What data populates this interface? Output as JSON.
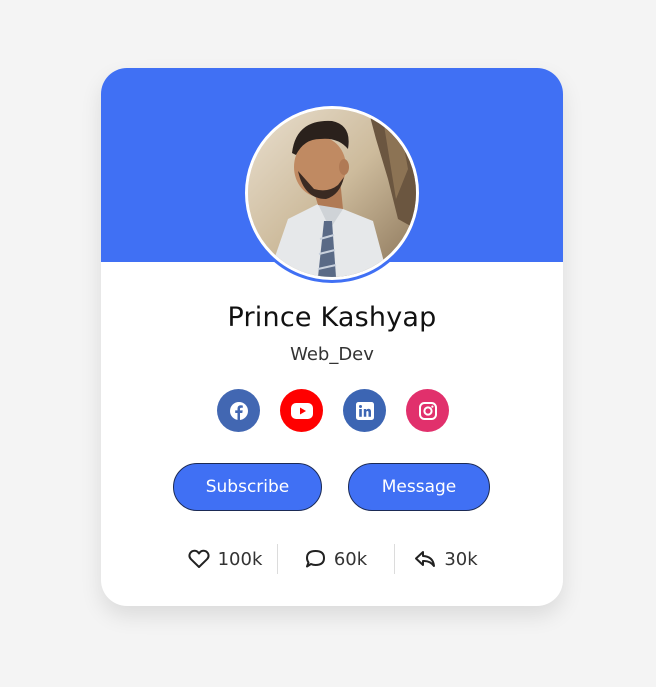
{
  "profile": {
    "name": "Prince Kashyap",
    "job": "Web_Dev"
  },
  "socials": [
    {
      "icon": "facebook-icon",
      "color": "#4267b2"
    },
    {
      "icon": "youtube-icon",
      "color": "#ff0000"
    },
    {
      "icon": "linkedin-icon",
      "color": "#3c65b3"
    },
    {
      "icon": "instagram-icon",
      "color": "#e1306c"
    }
  ],
  "buttons": {
    "subscribe": "Subscribe",
    "message": "Message"
  },
  "stats": {
    "likes": "100k",
    "comments": "60k",
    "shares": "30k"
  },
  "colors": {
    "accent": "#4070f4",
    "background": "#f4f4f4",
    "card": "#ffffff"
  }
}
